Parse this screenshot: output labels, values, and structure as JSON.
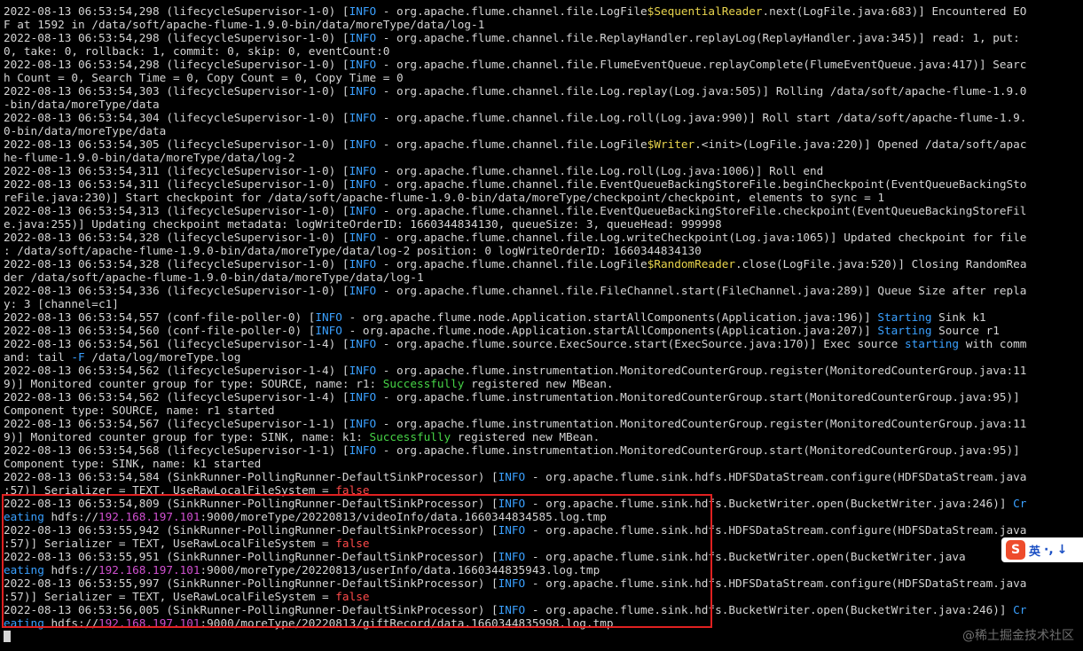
{
  "lines": [
    [
      {
        "t": "2022-08-13 06:53:54,298 (lifecycleSupervisor-1-0) ["
      },
      {
        "t": "INFO",
        "c": "blue"
      },
      {
        "t": " - org.apache.flume.channel.file.LogFile"
      },
      {
        "t": "$SequentialReader",
        "c": "yel"
      },
      {
        "t": ".next(LogFile.java:683)] Encountered EO"
      }
    ],
    [
      {
        "t": "F at 1592 in /data/soft/apache-flume-1.9.0-bin/data/moreType/data/log-1"
      }
    ],
    [
      {
        "t": "2022-08-13 06:53:54,298 (lifecycleSupervisor-1-0) ["
      },
      {
        "t": "INFO",
        "c": "blue"
      },
      {
        "t": " - org.apache.flume.channel.file.ReplayHandler.replayLog(ReplayHandler.java:345)] read: 1, put:"
      }
    ],
    [
      {
        "t": "0, take: 0, rollback: 1, commit: 0, skip: 0, eventCount:0"
      }
    ],
    [
      {
        "t": "2022-08-13 06:53:54,298 (lifecycleSupervisor-1-0) ["
      },
      {
        "t": "INFO",
        "c": "blue"
      },
      {
        "t": " - org.apache.flume.channel.file.FlumeEventQueue.replayComplete(FlumeEventQueue.java:417)] Searc"
      }
    ],
    [
      {
        "t": "h Count = 0, Search Time = 0, Copy Count = 0, Copy Time = 0"
      }
    ],
    [
      {
        "t": "2022-08-13 06:53:54,303 (lifecycleSupervisor-1-0) ["
      },
      {
        "t": "INFO",
        "c": "blue"
      },
      {
        "t": " - org.apache.flume.channel.file.Log.replay(Log.java:505)] Rolling /data/soft/apache-flume-1.9.0"
      }
    ],
    [
      {
        "t": "-bin/data/moreType/data"
      }
    ],
    [
      {
        "t": "2022-08-13 06:53:54,304 (lifecycleSupervisor-1-0) ["
      },
      {
        "t": "INFO",
        "c": "blue"
      },
      {
        "t": " - org.apache.flume.channel.file.Log.roll(Log.java:990)] Roll start /data/soft/apache-flume-1.9."
      }
    ],
    [
      {
        "t": "0-bin/data/moreType/data"
      }
    ],
    [
      {
        "t": "2022-08-13 06:53:54,305 (lifecycleSupervisor-1-0) ["
      },
      {
        "t": "INFO",
        "c": "blue"
      },
      {
        "t": " - org.apache.flume.channel.file.LogFile"
      },
      {
        "t": "$Writer",
        "c": "yel"
      },
      {
        "t": ".<init>(LogFile.java:220)] Opened /data/soft/apac"
      }
    ],
    [
      {
        "t": "he-flume-1.9.0-bin/data/moreType/data/log-2"
      }
    ],
    [
      {
        "t": "2022-08-13 06:53:54,311 (lifecycleSupervisor-1-0) ["
      },
      {
        "t": "INFO",
        "c": "blue"
      },
      {
        "t": " - org.apache.flume.channel.file.Log.roll(Log.java:1006)] Roll end"
      }
    ],
    [
      {
        "t": "2022-08-13 06:53:54,311 (lifecycleSupervisor-1-0) ["
      },
      {
        "t": "INFO",
        "c": "blue"
      },
      {
        "t": " - org.apache.flume.channel.file.EventQueueBackingStoreFile.beginCheckpoint(EventQueueBackingSto"
      }
    ],
    [
      {
        "t": "reFile.java:230)] Start checkpoint for /data/soft/apache-flume-1.9.0-bin/data/moreType/checkpoint/checkpoint, elements to sync = 1"
      }
    ],
    [
      {
        "t": "2022-08-13 06:53:54,313 (lifecycleSupervisor-1-0) ["
      },
      {
        "t": "INFO",
        "c": "blue"
      },
      {
        "t": " - org.apache.flume.channel.file.EventQueueBackingStoreFile.checkpoint(EventQueueBackingStoreFil"
      }
    ],
    [
      {
        "t": "e.java:255)] Updating checkpoint metadata: logWriteOrderID: 1660344834130, queueSize: 3, queueHead: 999998"
      }
    ],
    [
      {
        "t": "2022-08-13 06:53:54,328 (lifecycleSupervisor-1-0) ["
      },
      {
        "t": "INFO",
        "c": "blue"
      },
      {
        "t": " - org.apache.flume.channel.file.Log.writeCheckpoint(Log.java:1065)] Updated checkpoint for file"
      }
    ],
    [
      {
        "t": ": /data/soft/apache-flume-1.9.0-bin/data/moreType/data/log-2 position: 0 logWriteOrderID: 1660344834130"
      }
    ],
    [
      {
        "t": "2022-08-13 06:53:54,328 (lifecycleSupervisor-1-0) ["
      },
      {
        "t": "INFO",
        "c": "blue"
      },
      {
        "t": " - org.apache.flume.channel.file.LogFile"
      },
      {
        "t": "$RandomReader",
        "c": "yel"
      },
      {
        "t": ".close(LogFile.java:520)] Closing RandomRea"
      }
    ],
    [
      {
        "t": "der /data/soft/apache-flume-1.9.0-bin/data/moreType/data/log-1"
      }
    ],
    [
      {
        "t": "2022-08-13 06:53:54,336 (lifecycleSupervisor-1-0) ["
      },
      {
        "t": "INFO",
        "c": "blue"
      },
      {
        "t": " - org.apache.flume.channel.file.FileChannel.start(FileChannel.java:289)] Queue Size after repla"
      }
    ],
    [
      {
        "t": "y: 3 [channel=c1]"
      }
    ],
    [
      {
        "t": "2022-08-13 06:53:54,557 (conf-file-poller-0) ["
      },
      {
        "t": "INFO",
        "c": "blue"
      },
      {
        "t": " - org.apache.flume.node.Application.startAllComponents(Application.java:196)] "
      },
      {
        "t": "Starting",
        "c": "blue"
      },
      {
        "t": " Sink k1"
      }
    ],
    [
      {
        "t": "2022-08-13 06:53:54,560 (conf-file-poller-0) ["
      },
      {
        "t": "INFO",
        "c": "blue"
      },
      {
        "t": " - org.apache.flume.node.Application.startAllComponents(Application.java:207)] "
      },
      {
        "t": "Starting",
        "c": "blue"
      },
      {
        "t": " Source r1"
      }
    ],
    [
      {
        "t": "2022-08-13 06:53:54,561 (lifecycleSupervisor-1-4) ["
      },
      {
        "t": "INFO",
        "c": "blue"
      },
      {
        "t": " - org.apache.flume.source.ExecSource.start(ExecSource.java:170)] Exec source "
      },
      {
        "t": "starting",
        "c": "blue"
      },
      {
        "t": " with comm"
      }
    ],
    [
      {
        "t": "and: tail "
      },
      {
        "t": "-F",
        "c": "blue"
      },
      {
        "t": " /data/log/moreType.log"
      }
    ],
    [
      {
        "t": "2022-08-13 06:53:54,562 (lifecycleSupervisor-1-4) ["
      },
      {
        "t": "INFO",
        "c": "blue"
      },
      {
        "t": " - org.apache.flume.instrumentation.MonitoredCounterGroup.register(MonitoredCounterGroup.java:11"
      }
    ],
    [
      {
        "t": "9)] Monitored counter group for type: SOURCE, name: r1: "
      },
      {
        "t": "Successfully",
        "c": "grn"
      },
      {
        "t": " registered new MBean."
      }
    ],
    [
      {
        "t": "2022-08-13 06:53:54,562 (lifecycleSupervisor-1-4) ["
      },
      {
        "t": "INFO",
        "c": "blue"
      },
      {
        "t": " - org.apache.flume.instrumentation.MonitoredCounterGroup.start(MonitoredCounterGroup.java:95)]"
      }
    ],
    [
      {
        "t": "Component type: SOURCE, name: r1 started"
      }
    ],
    [
      {
        "t": "2022-08-13 06:53:54,567 (lifecycleSupervisor-1-1) ["
      },
      {
        "t": "INFO",
        "c": "blue"
      },
      {
        "t": " - org.apache.flume.instrumentation.MonitoredCounterGroup.register(MonitoredCounterGroup.java:11"
      }
    ],
    [
      {
        "t": "9)] Monitored counter group for type: SINK, name: k1: "
      },
      {
        "t": "Successfully",
        "c": "grn"
      },
      {
        "t": " registered new MBean."
      }
    ],
    [
      {
        "t": "2022-08-13 06:53:54,568 (lifecycleSupervisor-1-1) ["
      },
      {
        "t": "INFO",
        "c": "blue"
      },
      {
        "t": " - org.apache.flume.instrumentation.MonitoredCounterGroup.start(MonitoredCounterGroup.java:95)]"
      }
    ],
    [
      {
        "t": "Component type: SINK, name: k1 started"
      }
    ],
    [
      {
        "t": "2022-08-13 06:53:54,584 (SinkRunner-PollingRunner-DefaultSinkProcessor) ["
      },
      {
        "t": "INFO",
        "c": "blue"
      },
      {
        "t": " - org.apache.flume.sink.hdfs.HDFSDataStream.configure(HDFSDataStream.java"
      }
    ],
    [
      {
        "t": ":57)] Serializer = TEXT, UseRawLocalFileSystem = "
      },
      {
        "t": "false",
        "c": "red"
      }
    ],
    [
      {
        "t": "2022-08-13 06:53:54,809 (SinkRunner-PollingRunner-DefaultSinkProcessor) ["
      },
      {
        "t": "INFO",
        "c": "blue"
      },
      {
        "t": " - org.apache.flume.sink.hdfs.BucketWriter.open(BucketWriter.java:246)] "
      },
      {
        "t": "Cr",
        "c": "blue"
      }
    ],
    [
      {
        "t": "eating",
        "c": "blue"
      },
      {
        "t": " hdfs://"
      },
      {
        "t": "192.168.197.101",
        "c": "mag"
      },
      {
        "t": ":9000/moreType/20220813/videoInfo/data.1660344834585.log.tmp"
      }
    ],
    [
      {
        "t": "2022-08-13 06:53:55,942 (SinkRunner-PollingRunner-DefaultSinkProcessor) ["
      },
      {
        "t": "INFO",
        "c": "blue"
      },
      {
        "t": " - org.apache.flume.sink.hdfs.HDFSDataStream.configure(HDFSDataStream.java"
      }
    ],
    [
      {
        "t": ":57)] Serializer = TEXT, UseRawLocalFileSystem = "
      },
      {
        "t": "false",
        "c": "red"
      }
    ],
    [
      {
        "t": "2022-08-13 06:53:55,951 (SinkRunner-PollingRunner-DefaultSinkProcessor) ["
      },
      {
        "t": "INFO",
        "c": "blue"
      },
      {
        "t": " - org.apache.flume.sink.hdfs.BucketWriter.open(BucketWriter.java"
      }
    ],
    [
      {
        "t": "eating",
        "c": "blue"
      },
      {
        "t": " hdfs://"
      },
      {
        "t": "192.168.197.101",
        "c": "mag"
      },
      {
        "t": ":9000/moreType/20220813/userInfo/data.1660344835943.log.tmp"
      }
    ],
    [
      {
        "t": "2022-08-13 06:53:55,997 (SinkRunner-PollingRunner-DefaultSinkProcessor) ["
      },
      {
        "t": "INFO",
        "c": "blue"
      },
      {
        "t": " - org.apache.flume.sink.hdfs.HDFSDataStream.configure(HDFSDataStream.java"
      }
    ],
    [
      {
        "t": ":57)] Serializer = TEXT, UseRawLocalFileSystem = "
      },
      {
        "t": "false",
        "c": "red"
      }
    ],
    [
      {
        "t": "2022-08-13 06:53:56,005 (SinkRunner-PollingRunner-DefaultSinkProcessor) ["
      },
      {
        "t": "INFO",
        "c": "blue"
      },
      {
        "t": " - org.apache.flume.sink.hdfs.BucketWriter.open(BucketWriter.java:246)] "
      },
      {
        "t": "Cr",
        "c": "blue"
      }
    ],
    [
      {
        "t": "eating",
        "c": "blue"
      },
      {
        "t": " hdfs://"
      },
      {
        "t": "192.168.197.101",
        "c": "mag"
      },
      {
        "t": ":9000/moreType/20220813/giftRecord/data.1660344835998.log.tmp"
      }
    ]
  ],
  "ime": {
    "logo": "S",
    "mode_label": "英",
    "punct": "·,",
    "extra": "↓"
  },
  "watermark": "@稀土掘金技术社区",
  "colors": {
    "background": "#000000",
    "text": "#d4d4d4",
    "info": "#3aa0ff",
    "ip": "#d050d0",
    "class_suffix": "#e8d44d",
    "success": "#47d447",
    "false": "#ff4a4a",
    "highlight": "#e02020"
  }
}
